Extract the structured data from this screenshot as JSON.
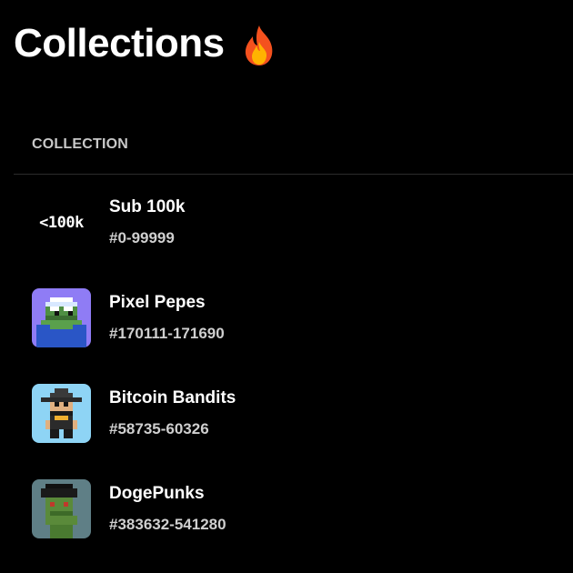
{
  "header": {
    "title": "Collections",
    "icon": "fire-icon"
  },
  "table": {
    "column_header": "COLLECTION"
  },
  "collections": [
    {
      "name": "Sub 100k",
      "range": "#0-99999",
      "thumb_text": "<100k",
      "icon": "sub100k-thumbnail",
      "bg": "#000000"
    },
    {
      "name": "Pixel Pepes",
      "range": "#170111-171690",
      "icon": "pixel-pepe-avatar",
      "bg": "#8f7cf5"
    },
    {
      "name": "Bitcoin Bandits",
      "range": "#58735-60326",
      "icon": "bitcoin-bandit-avatar",
      "bg": "#8ed4f5"
    },
    {
      "name": "DogePunks",
      "range": "#383632-541280",
      "icon": "dogepunk-avatar",
      "bg": "#5f7f86"
    }
  ]
}
